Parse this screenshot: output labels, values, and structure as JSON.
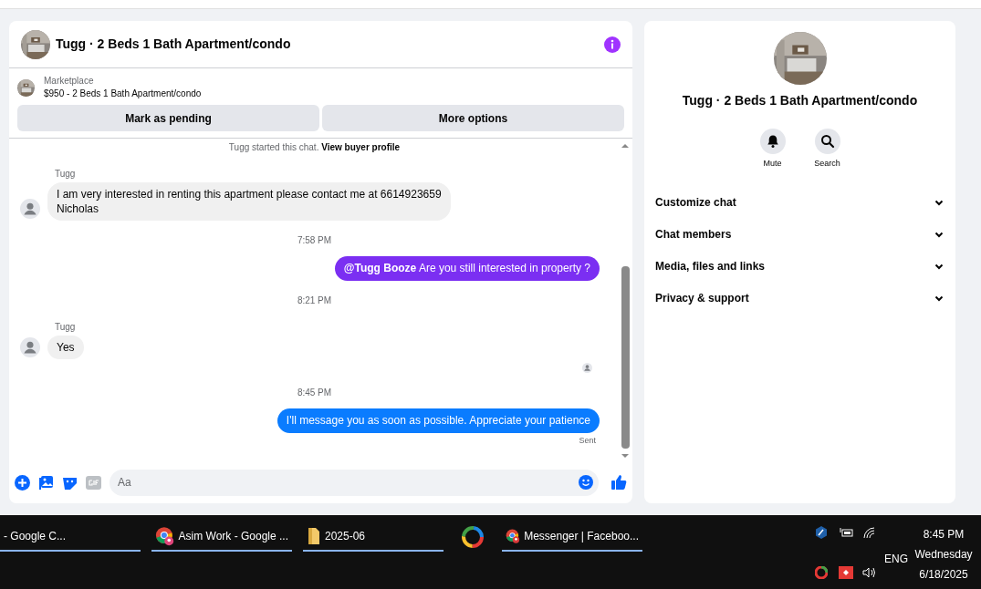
{
  "chat": {
    "title": "Tugg · 2 Beds 1 Bath Apartment/condo",
    "listing": {
      "source": "Marketplace",
      "item": "$950 - 2 Beds 1 Bath Apartment/condo"
    },
    "actions": [
      "Mark as pending",
      "More options"
    ],
    "messages": [
      {
        "kind": "notice",
        "text": "Tugg started this chat.",
        "link": "View buyer profile"
      },
      {
        "kind": "incoming",
        "sender": "Tugg",
        "text": "I am very interested in renting this apartment please contact me at 6614923659\nNicholas"
      },
      {
        "kind": "time",
        "text": "7:58 PM"
      },
      {
        "kind": "outgoing",
        "text": "**@Tugg Booze** Are you still interested in property ?",
        "color": "#7b2ff2"
      },
      {
        "kind": "time",
        "text": "8:21 PM"
      },
      {
        "kind": "incoming",
        "sender": "Tugg",
        "text": "Yes"
      },
      {
        "kind": "seen"
      },
      {
        "kind": "time",
        "text": "8:45 PM"
      },
      {
        "kind": "outgoing",
        "text": "I'll message you as soon as possible. Appreciate your patience",
        "color": "#0a7cff",
        "status": "Sent"
      }
    ],
    "composer": {
      "placeholder": "Aa"
    }
  },
  "details": {
    "title": "Tugg · 2 Beds 1 Bath Apartment/condo",
    "quick_actions": [
      {
        "kind": "mute",
        "label": "Mute"
      },
      {
        "kind": "search",
        "label": "Search"
      }
    ],
    "sections": [
      {
        "label": "Customize chat",
        "expanded": false
      },
      {
        "label": "Chat members",
        "expanded": false
      },
      {
        "label": "Media, files and links",
        "expanded": false
      },
      {
        "label": "Privacy & support",
        "expanded": false
      }
    ]
  },
  "taskbar": {
    "apps": [
      {
        "kind": "chrome",
        "label": "- Google C..."
      },
      {
        "kind": "chrome-h",
        "label": "Asim Work - Google ..."
      },
      {
        "kind": "folder",
        "label": "2025-06"
      },
      {
        "kind": "ring"
      },
      {
        "kind": "chrome-p",
        "label": "Messenger | Faceboo..."
      }
    ],
    "language": "ENG",
    "time": "8:45 PM",
    "day": "Wednesday",
    "date": "6/18/2025"
  }
}
